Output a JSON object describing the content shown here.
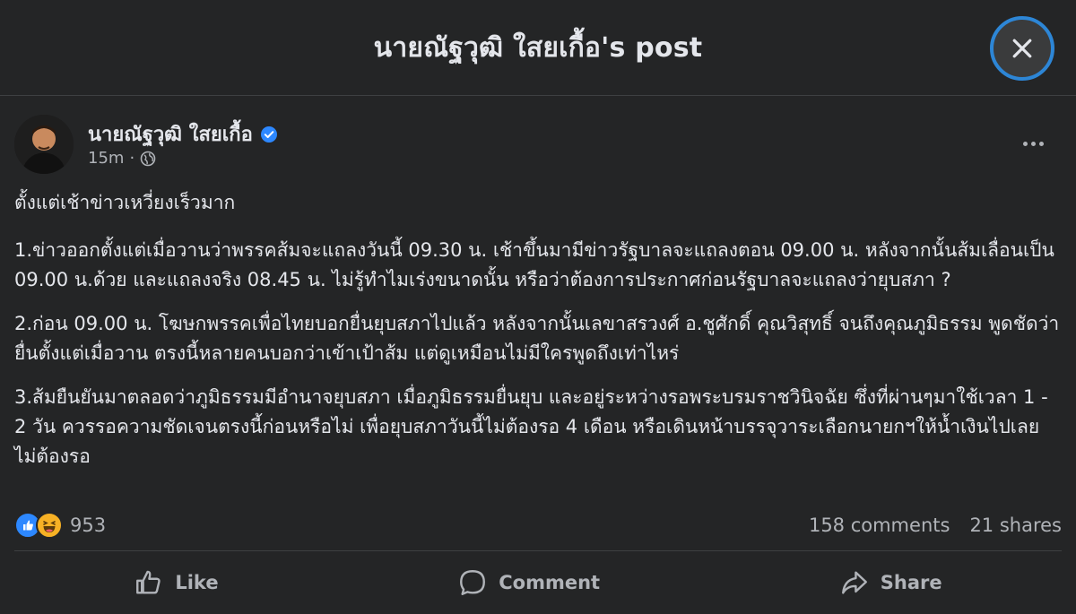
{
  "modal": {
    "title": "นายณัฐวุฒิ ใสยเกื้อ's post"
  },
  "post": {
    "author": "นายณัฐวุฒิ ใสยเกื้อ",
    "time": "15m",
    "separator": "·",
    "paragraphs": [
      "ตั้งแต่เช้าข่าวเหวี่ยงเร็วมาก",
      "1.ข่าวออกตั้งแต่เมื่อวานว่าพรรคส้มจะแถลงวันนี้ 09.30 น. เช้าขึ้นมามีข่าวรัฐบาลจะแถลงตอน 09.00 น. หลังจากนั้นส้มเลื่อนเป็น 09.00 น.ด้วย และแถลงจริง 08.45 น. ไม่รู้ทำไมเร่งขนาดนั้น หรือว่าต้องการประกาศก่อนรัฐบาลจะแถลงว่ายุบสภา ?",
      "2.ก่อน 09.00 น. โฆษกพรรคเพื่อไทยบอกยื่นยุบสภาไปแล้ว หลังจากนั้นเลขาสรวงศ์ อ.ชูศักดิ์ คุณวิสุทธิ์ จนถึงคุณภูมิธรรม พูดชัดว่ายื่นตั้งแต่เมื่อวาน ตรงนี้หลายคนบอกว่าเข้าเป้าส้ม แต่ดูเหมือนไม่มีใครพูดถึงเท่าไหร่",
      "3.ส้มยืนยันมาตลอดว่าภูมิธรรมมีอำนาจยุบสภา เมื่อภูมิธรรมยื่นยุบ และอยู่ระหว่างรอพระบรมราชวินิจฉัย ซึ่งที่ผ่านๆมาใช้เวลา 1 - 2 วัน ควรรอความชัดเจนตรงนี้ก่อนหรือไม่ เพื่อยุบสภาวันนี้ไม่ต้องรอ 4 เดือน หรือเดินหน้าบรรจุวาระเลือกนายกฯให้น้ำเงินไปเลย ไม่ต้องรอ"
    ],
    "reaction_count": "953",
    "comments": "158 comments",
    "shares": "21 shares"
  },
  "actions": {
    "like": "Like",
    "comment": "Comment",
    "share": "Share"
  },
  "icons": {
    "close": "close-icon",
    "verified": "verified-badge-icon",
    "globe": "globe-icon",
    "more": "more-icon",
    "like_reaction": "like-reaction-icon",
    "haha_reaction": "haha-reaction-icon"
  },
  "colors": {
    "background": "#242526",
    "text_primary": "#e4e6eb",
    "text_secondary": "#b0b3b8",
    "accent_blue": "#2d88ff",
    "haha_yellow": "#f7b125"
  }
}
